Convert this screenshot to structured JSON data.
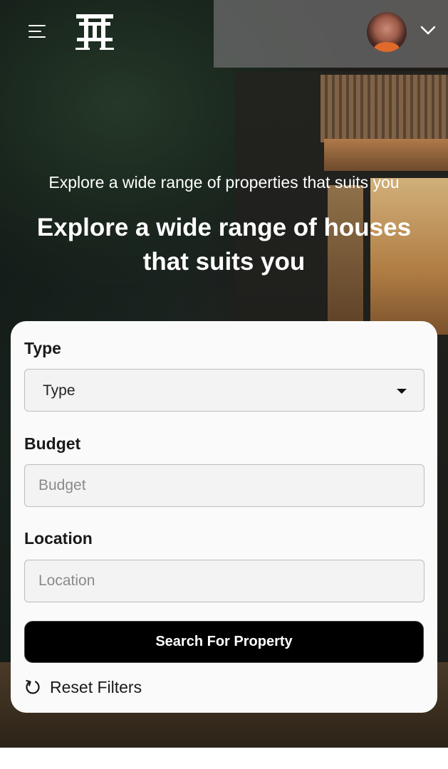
{
  "header": {
    "menu_icon": "hamburger-menu-icon",
    "logo_icon": "torii-gate-logo-icon",
    "avatar_icon": "user-avatar",
    "account_menu_icon": "chevron-down-icon"
  },
  "hero": {
    "subtitle": "Explore a wide range of properties that suits you",
    "headline_line1": "Explore a wide range of houses",
    "headline_line2": "that suits you"
  },
  "search_form": {
    "type_label": "Type",
    "type_selected": "Type",
    "budget_label": "Budget",
    "budget_placeholder": "Budget",
    "location_label": "Location",
    "location_placeholder": "Location",
    "submit_label": "Search For Property",
    "reset_label": "Reset Filters",
    "reset_icon": "refresh-icon"
  },
  "colors": {
    "button_bg": "#000000",
    "card_bg": "#fafafa",
    "text_light": "#ffffff"
  }
}
